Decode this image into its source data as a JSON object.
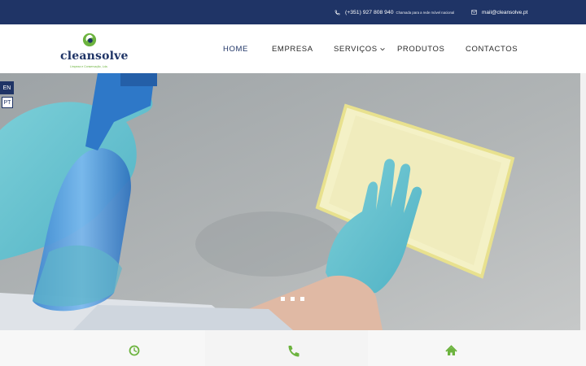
{
  "topbar": {
    "phone_number": "(+351) 927 808 940",
    "phone_note": "Chamada para a rede móvel nacional",
    "email": "mail@cleansolve.pt",
    "phone_icon": "phone-icon",
    "mail_icon": "envelope-icon"
  },
  "logo": {
    "name": "cleansolve",
    "tagline": "Limpeza e Conservação, Lda."
  },
  "nav": {
    "items": [
      "HOME",
      "EMPRESA",
      "SERVIÇOS",
      "PRODUTOS",
      "CONTACTOS"
    ],
    "active": "HOME",
    "dropdown_icon": "chevron-down-icon"
  },
  "language": {
    "options": [
      "EN",
      "PT"
    ],
    "selected": "EN"
  },
  "slider": {
    "slide_count": 3
  },
  "info_icons": [
    "clock-icon",
    "phone-icon",
    "home-icon"
  ],
  "colors": {
    "topbar": "#1f3466",
    "brand_blue": "#1f3466",
    "brand_green": "#6cb33e",
    "info_strip": "#f7f7f7"
  }
}
